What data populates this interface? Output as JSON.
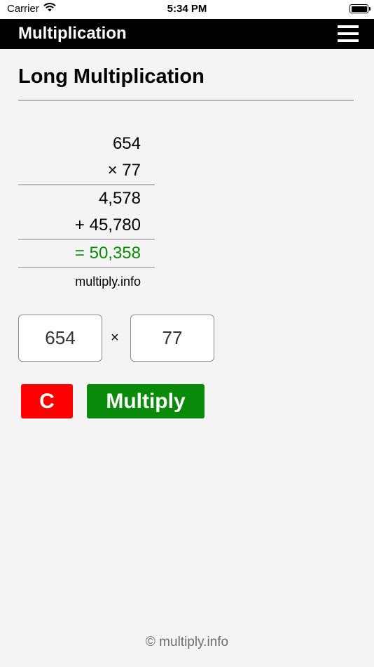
{
  "status_bar": {
    "carrier": "Carrier",
    "time": "5:34 PM",
    "battery_level": 1.0
  },
  "header": {
    "title": "Multiplication",
    "menu_icon": "hamburger-menu-icon"
  },
  "page": {
    "title": "Long Multiplication"
  },
  "calculation": {
    "multiplicand": "654",
    "multiplier": "× 77",
    "partial_products": [
      "4,578",
      "+ 45,780"
    ],
    "result": "= 50,358",
    "brand": "multiply.info"
  },
  "inputs": {
    "first_value": "654",
    "operator": "×",
    "second_value": "77"
  },
  "buttons": {
    "clear_label": "C",
    "multiply_label": "Multiply"
  },
  "colors": {
    "header_bg": "#000000",
    "result_text": "#0b8a0b",
    "clear_button": "#ff0000",
    "multiply_button": "#0a8a0a"
  },
  "footer": {
    "copyright": "© multiply.info"
  }
}
